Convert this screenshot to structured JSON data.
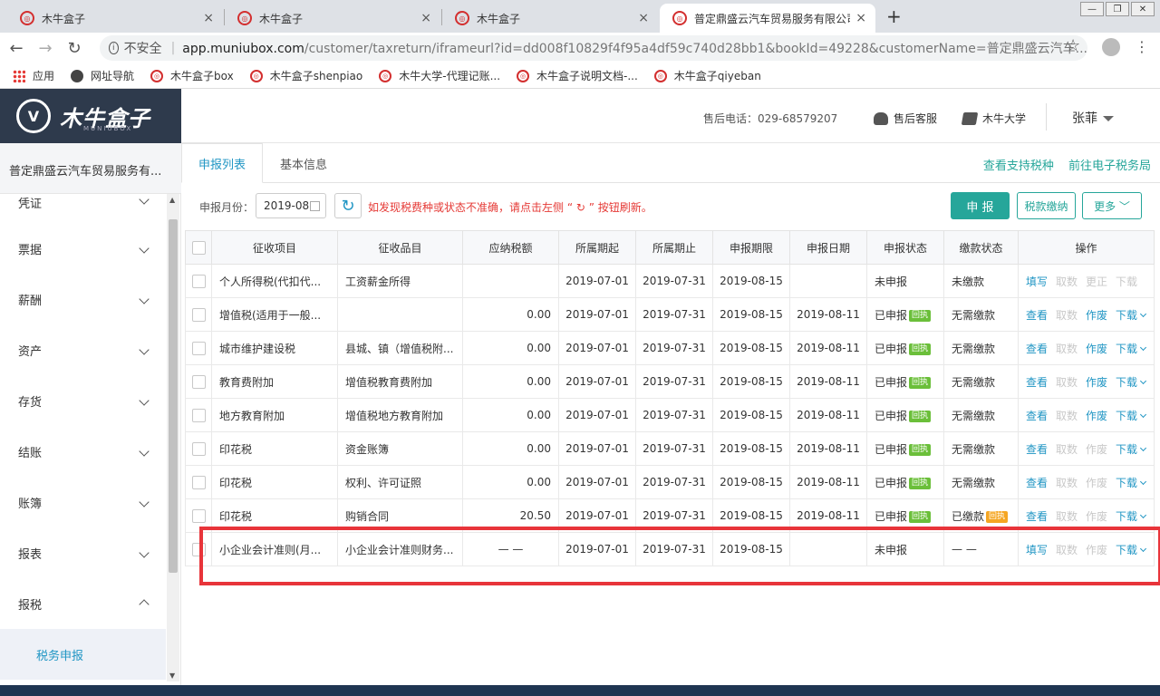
{
  "browser": {
    "tabs": [
      {
        "title": "木牛盒子",
        "close": "×"
      },
      {
        "title": "木牛盒子",
        "close": "×"
      },
      {
        "title": "木牛盒子",
        "close": "×"
      },
      {
        "title": "普定鼎盛云汽车贸易服务有限公司",
        "close": "×"
      }
    ],
    "new_tab": "+",
    "window_controls": [
      "—",
      "❐",
      "✕"
    ],
    "nav": {
      "back": "←",
      "forward": "→",
      "reload": "↻"
    },
    "address": {
      "security": "不安全",
      "host": "app.muniubox.com",
      "path": "/customer/taxreturn/iframeurl?id=dd008f10829f4f95a4df59c740d28bb1&bookId=49228&customerName=普定鼎盛云汽车..."
    },
    "star": "☆",
    "menu": "⋮",
    "bookmarks": [
      {
        "label": "应用",
        "icon": "apps-icon"
      },
      {
        "label": "网址导航",
        "icon": "globe-icon"
      },
      {
        "label": "木牛盒子box",
        "icon": "muniu-icon"
      },
      {
        "label": "木牛盒子shenpiao",
        "icon": "muniu-icon"
      },
      {
        "label": "木牛大学-代理记账...",
        "icon": "muniu-icon"
      },
      {
        "label": "木牛盒子说明文档-...",
        "icon": "muniu-icon"
      },
      {
        "label": "木牛盒子qiyeban",
        "icon": "muniu-icon"
      }
    ]
  },
  "app": {
    "logo_text": "木牛盒子",
    "logo_sub": "MUNIUBOX",
    "hotline": "售后电话：029-68579207",
    "service": "售后客服",
    "university": "木牛大学",
    "user": "张菲",
    "company": "普定鼎盛云汽车贸易服务有...",
    "menu": [
      {
        "label": "凭证",
        "state": "down"
      },
      {
        "label": "票据",
        "state": "down"
      },
      {
        "label": "薪酬",
        "state": "down"
      },
      {
        "label": "资产",
        "state": "down"
      },
      {
        "label": "存货",
        "state": "down"
      },
      {
        "label": "结账",
        "state": "down"
      },
      {
        "label": "账簿",
        "state": "down"
      },
      {
        "label": "报表",
        "state": "down"
      },
      {
        "label": "报税",
        "state": "up"
      }
    ],
    "submenu_active": "税务申报"
  },
  "content": {
    "tabs": [
      "申报列表",
      "基本信息"
    ],
    "links": [
      "查看支持税种",
      "前往电子税务局"
    ],
    "filter_label": "申报月份：",
    "filter_value": "2019-08",
    "warning": "如发现税费种或状态不准确，请点击左侧 “ ↻ ” 按钮刷新。",
    "btn_declare": "申 报",
    "btn_pay": "税款缴纳",
    "btn_more": "更多 ﹀",
    "columns": [
      "征收项目",
      "征收品目",
      "应纳税额",
      "所属期起",
      "所属期止",
      "申报期限",
      "申报日期",
      "申报状态",
      "缴款状态",
      "操作"
    ],
    "rows": [
      {
        "item": "个人所得税(代扣代...",
        "sub": "工资薪金所得",
        "amount": "",
        "start": "2019-07-01",
        "end": "2019-07-31",
        "deadline": "2019-08-15",
        "date": "",
        "status": "未申报",
        "status_badge": "",
        "pay": "未缴款",
        "pay_badge": "",
        "ops": [
          "填写",
          "取数",
          "更正",
          "下载"
        ],
        "ops_on": [
          true,
          false,
          false,
          false
        ],
        "download_menu": false
      },
      {
        "item": "增值税(适用于一般...",
        "sub": "",
        "amount": "0.00",
        "start": "2019-07-01",
        "end": "2019-07-31",
        "deadline": "2019-08-15",
        "date": "2019-08-11",
        "status": "已申报",
        "status_badge": "回执",
        "pay": "无需缴款",
        "pay_badge": "",
        "ops": [
          "查看",
          "取数",
          "作废",
          "下载"
        ],
        "ops_on": [
          true,
          false,
          true,
          true
        ],
        "download_menu": true
      },
      {
        "item": "城市维护建设税",
        "sub": "县城、镇（增值税附...",
        "amount": "0.00",
        "start": "2019-07-01",
        "end": "2019-07-31",
        "deadline": "2019-08-15",
        "date": "2019-08-11",
        "status": "已申报",
        "status_badge": "回执",
        "pay": "无需缴款",
        "pay_badge": "",
        "ops": [
          "查看",
          "取数",
          "作废",
          "下载"
        ],
        "ops_on": [
          true,
          false,
          true,
          true
        ],
        "download_menu": true
      },
      {
        "item": "教育费附加",
        "sub": "增值税教育费附加",
        "amount": "0.00",
        "start": "2019-07-01",
        "end": "2019-07-31",
        "deadline": "2019-08-15",
        "date": "2019-08-11",
        "status": "已申报",
        "status_badge": "回执",
        "pay": "无需缴款",
        "pay_badge": "",
        "ops": [
          "查看",
          "取数",
          "作废",
          "下载"
        ],
        "ops_on": [
          true,
          false,
          true,
          true
        ],
        "download_menu": true
      },
      {
        "item": "地方教育附加",
        "sub": "增值税地方教育附加",
        "amount": "0.00",
        "start": "2019-07-01",
        "end": "2019-07-31",
        "deadline": "2019-08-15",
        "date": "2019-08-11",
        "status": "已申报",
        "status_badge": "回执",
        "pay": "无需缴款",
        "pay_badge": "",
        "ops": [
          "查看",
          "取数",
          "作废",
          "下载"
        ],
        "ops_on": [
          true,
          false,
          true,
          true
        ],
        "download_menu": true
      },
      {
        "item": "印花税",
        "sub": "资金账簿",
        "amount": "0.00",
        "start": "2019-07-01",
        "end": "2019-07-31",
        "deadline": "2019-08-15",
        "date": "2019-08-11",
        "status": "已申报",
        "status_badge": "回执",
        "pay": "无需缴款",
        "pay_badge": "",
        "ops": [
          "查看",
          "取数",
          "作废",
          "下载"
        ],
        "ops_on": [
          true,
          false,
          false,
          true
        ],
        "download_menu": true
      },
      {
        "item": "印花税",
        "sub": "权利、许可证照",
        "amount": "0.00",
        "start": "2019-07-01",
        "end": "2019-07-31",
        "deadline": "2019-08-15",
        "date": "2019-08-11",
        "status": "已申报",
        "status_badge": "回执",
        "pay": "无需缴款",
        "pay_badge": "",
        "ops": [
          "查看",
          "取数",
          "作废",
          "下载"
        ],
        "ops_on": [
          true,
          false,
          false,
          true
        ],
        "download_menu": true
      },
      {
        "item": "印花税",
        "sub": "购销合同",
        "amount": "20.50",
        "start": "2019-07-01",
        "end": "2019-07-31",
        "deadline": "2019-08-15",
        "date": "2019-08-11",
        "status": "已申报",
        "status_badge": "回执",
        "pay": "已缴款",
        "pay_badge": "回执",
        "ops": [
          "查看",
          "取数",
          "作废",
          "下载"
        ],
        "ops_on": [
          true,
          false,
          false,
          true
        ],
        "download_menu": true
      },
      {
        "item": "小企业会计准则(月...",
        "sub": "小企业会计准则财务...",
        "amount": "— —",
        "start": "2019-07-01",
        "end": "2019-07-31",
        "deadline": "2019-08-15",
        "date": "",
        "status": "未申报",
        "status_badge": "",
        "pay": "— —",
        "pay_badge": "",
        "ops": [
          "填写",
          "取数",
          "作废",
          "下载"
        ],
        "ops_on": [
          true,
          false,
          false,
          true
        ],
        "download_menu": true
      }
    ]
  },
  "colors": {
    "accent": "#26a69a",
    "link": "#2196c4",
    "highlight": "#e8343a",
    "header_dark": "#2e3a4c"
  }
}
